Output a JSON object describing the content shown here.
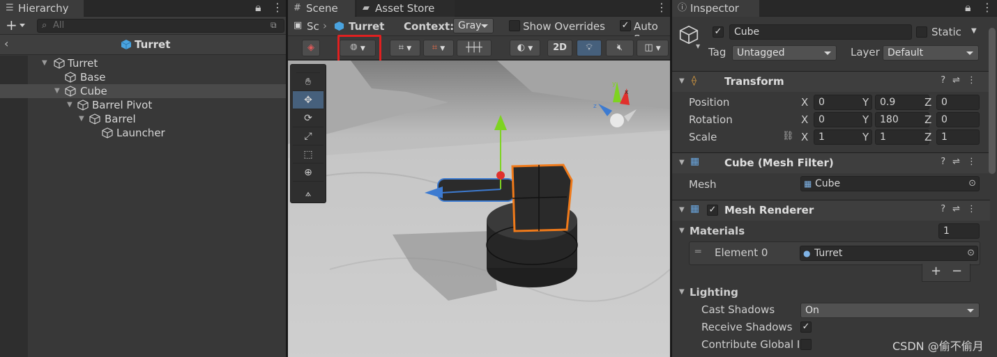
{
  "hierarchy": {
    "tab": "Hierarchy",
    "add": "+",
    "search_placeholder": "All",
    "scene_title": "Turret",
    "items": [
      {
        "name": "Turret"
      },
      {
        "name": "Base"
      },
      {
        "name": "Cube"
      },
      {
        "name": "Barrel Pivot"
      },
      {
        "name": "Barrel"
      },
      {
        "name": "Launcher"
      }
    ]
  },
  "scene": {
    "tabs": [
      "Scene",
      "Asset Store"
    ],
    "breadcrumb": [
      "Sc",
      "Turret"
    ],
    "context_label": "Context:",
    "context_value": "Gray",
    "show_overrides": "Show Overrides",
    "auto_save": "Auto Sa",
    "btn_2d": "2D",
    "highlight_color": "#e02020"
  },
  "inspector": {
    "tab": "Inspector",
    "object_name": "Cube",
    "static": "Static",
    "tag_label": "Tag",
    "tag_value": "Untagged",
    "layer_label": "Layer",
    "layer_value": "Default",
    "transform": {
      "title": "Transform",
      "rows": [
        {
          "label": "Position",
          "x": "0",
          "y": "0.9",
          "z": "0"
        },
        {
          "label": "Rotation",
          "x": "0",
          "y": "180",
          "z": "0"
        },
        {
          "label": "Scale",
          "x": "1",
          "y": "1",
          "z": "1"
        }
      ]
    },
    "mesh_filter": {
      "title": "Cube (Mesh Filter)",
      "mesh_label": "Mesh",
      "mesh_value": "Cube"
    },
    "mesh_renderer": {
      "title": "Mesh Renderer",
      "materials_label": "Materials",
      "materials_count": "1",
      "element_label": "Element 0",
      "element_value": "Turret",
      "plus": "+",
      "minus": "−",
      "lighting": "Lighting",
      "cast_shadows_label": "Cast Shadows",
      "cast_shadows_value": "On",
      "receive_shadows_label": "Receive Shadows",
      "contribute_gi_label": "Contribute Global Il"
    }
  },
  "watermark": "CSDN @偷不偷月"
}
